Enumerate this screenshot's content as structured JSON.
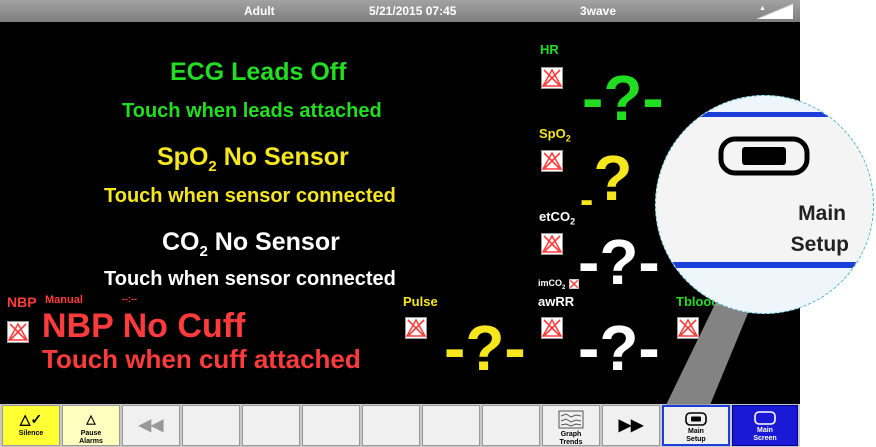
{
  "topbar": {
    "patient_type": "Adult",
    "datetime": "5/21/2015 07:45",
    "wave_layout": "3wave"
  },
  "ecg": {
    "message": "ECG Leads Off",
    "hint": "Touch when leads attached",
    "param_label": "HR",
    "value": "-?-",
    "color": "#22dd22"
  },
  "spo2": {
    "message_prefix": "SpO",
    "message_sub": "2",
    "message_suffix": " No Sensor",
    "hint": "Touch when sensor connected",
    "param_label_prefix": "SpO",
    "param_label_sub": "2",
    "value": "?",
    "color": "#f5e61e"
  },
  "co2": {
    "message_prefix": "CO",
    "message_sub": "2",
    "message_suffix": " No Sensor",
    "hint": "Touch when sensor connected",
    "param_label_prefix": "etCO",
    "param_label_sub": "2",
    "value": "-?-",
    "color": "#ffffff"
  },
  "imco2": {
    "label_prefix": "imCO",
    "label_sub": "2"
  },
  "awrr": {
    "label": "awRR",
    "value": "-?-"
  },
  "nbp": {
    "label": "NBP",
    "mode": "Manual",
    "time": "--:--",
    "message": "NBP No Cuff",
    "hint": "Touch when cuff attached",
    "color": "#ff3b3b"
  },
  "pulse": {
    "label": "Pulse",
    "value": "-?-"
  },
  "tblood": {
    "label": "Tblood"
  },
  "zoom": {
    "label_line1": "Main",
    "label_line2": "Setup"
  },
  "statusbar": {
    "silence": "Silence",
    "pause_alarms_line1": "Pause",
    "pause_alarms_line2": "Alarms",
    "graph_trends_line1": "Graph",
    "graph_trends_line2": "Trends",
    "main_setup_line1": "Main",
    "main_setup_line2": "Setup",
    "main_screen_line1": "Main",
    "main_screen_line2": "Screen"
  },
  "icons": {
    "silence": "bell-check-icon",
    "pause": "bell-triangle-icon",
    "rewind": "rewind-icon",
    "forward": "fast-forward-icon",
    "graph": "graph-trends-icon",
    "setup": "monitor-setup-icon",
    "screen": "main-screen-icon",
    "no_sensor": "no-sensor-icon"
  },
  "colors": {
    "silence_bg": "#ffff33",
    "pause_bg": "#ffffc0",
    "main_screen_bg": "#1a1ad6",
    "zoom_accent": "#1c3fd9"
  }
}
